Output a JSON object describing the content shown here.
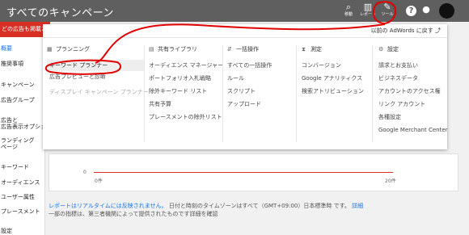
{
  "header": {
    "title": "すべてのキャンペーン",
    "icons": [
      {
        "name": "search-icon",
        "label": "移動"
      },
      {
        "name": "reports-icon",
        "label": "レポート"
      },
      {
        "name": "tools-icon",
        "label": "ツール"
      }
    ],
    "help": "?"
  },
  "alert": {
    "text": "どの広告も掲載されて"
  },
  "leftnav": {
    "items": [
      "概要",
      "推奨事項",
      "キャンペーン",
      "広告グループ",
      "広告と",
      "広告表示オプション",
      "ランディング",
      "ページ",
      "キーワード",
      "オーディエンス",
      "ユーザー属性",
      "プレースメント",
      "設定"
    ]
  },
  "panel": {
    "old_link": "以前の AdWords に戻す",
    "columns": [
      {
        "icon": "calendar-icon",
        "heading": "プランニング",
        "items": [
          "キーワード プランナー",
          "広告プレビューと診断",
          "ディスプレイ キャンペーン プランナー"
        ]
      },
      {
        "icon": "library-icon",
        "heading": "共有ライブラリ",
        "items": [
          "オーディエンス マネージャー",
          "ポートフォリオ入札戦略",
          "除外キーワード リスト",
          "共有予算",
          "プレースメントの除外リスト"
        ]
      },
      {
        "icon": "bulk-actions-icon",
        "heading": "一括操作",
        "items": [
          "すべての一括操作",
          "ルール",
          "スクリプト",
          "アップロード"
        ]
      },
      {
        "icon": "measurement-icon",
        "heading": "測定",
        "items": [
          "コンバージョン",
          "Google アナリティクス",
          "検索アトリビューション"
        ]
      },
      {
        "icon": "settings-icon",
        "heading": "設定",
        "items": [
          "請求とお支払い",
          "ビジネスデータ",
          "アカウントのアクセス権",
          "リンク アカウント",
          "各種設定",
          "Google Merchant Center"
        ]
      }
    ]
  },
  "chart": {
    "zero": "0",
    "x_start": "0件",
    "x_end": "20件"
  },
  "footer": {
    "link1": "レポートはリアルタイムには反映されません。",
    "text1": "日付と時刻のタイムゾーンはすべて（GMT+09:00）日本標準時 です。",
    "link2": "詳細",
    "text2": "一部の指標は、第三者機関によって提供されたものです詳細を確認"
  },
  "colors": {
    "topbar": "#5f5f5f",
    "annotation": "#e00000",
    "link": "#1a73e8"
  }
}
